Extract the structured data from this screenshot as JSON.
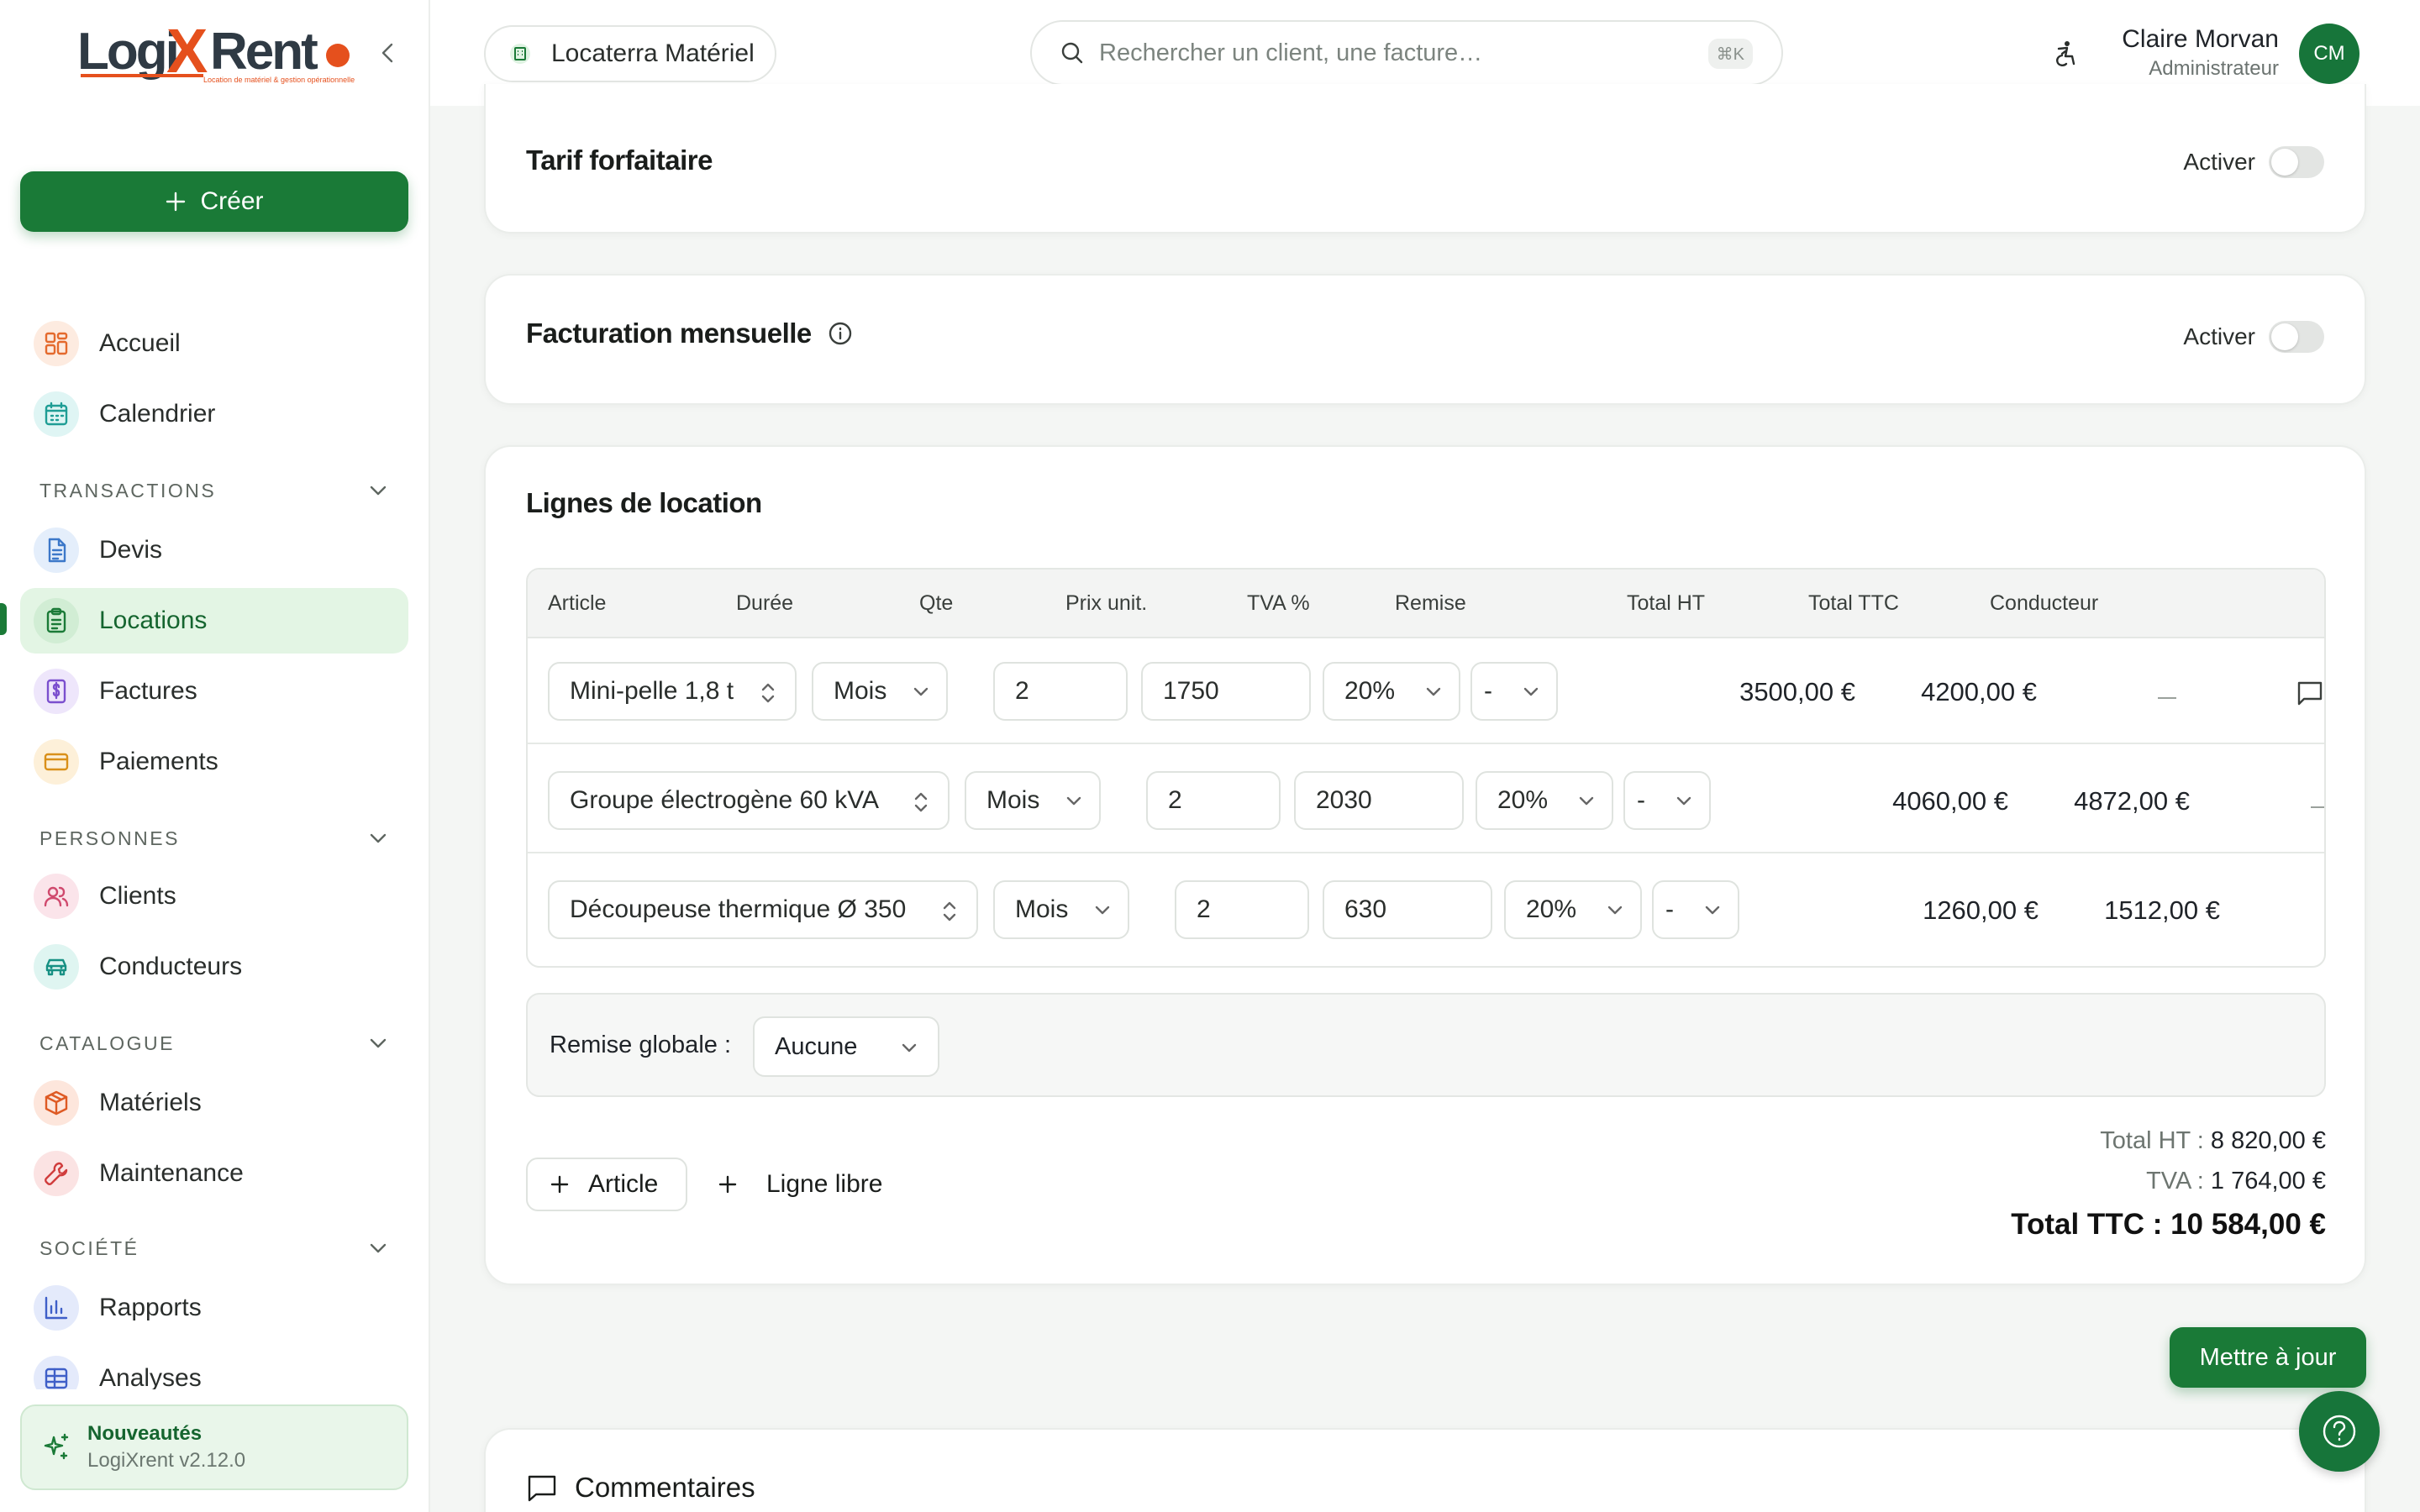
{
  "brand": {
    "logo_text": "LogiXRent",
    "logo_tagline": "Location de matériel & gestion opérationnelle",
    "accent": "#1a7a37"
  },
  "sidebar": {
    "create_label": "Créer",
    "items": [
      {
        "label": "Accueil",
        "icon": "dashboard-icon"
      },
      {
        "label": "Calendrier",
        "icon": "calendar-icon"
      },
      {
        "label": "Devis",
        "icon": "document-icon"
      },
      {
        "label": "Locations",
        "icon": "clipboard-icon",
        "active": true
      },
      {
        "label": "Factures",
        "icon": "dollar-file-icon"
      },
      {
        "label": "Paiements",
        "icon": "card-icon"
      },
      {
        "label": "Clients",
        "icon": "users-icon"
      },
      {
        "label": "Conducteurs",
        "icon": "car-icon"
      },
      {
        "label": "Matériels",
        "icon": "package-icon"
      },
      {
        "label": "Maintenance",
        "icon": "wrench-icon"
      },
      {
        "label": "Rapports",
        "icon": "bar-chart-icon"
      },
      {
        "label": "Analyses",
        "icon": "table-chart-icon"
      }
    ],
    "sections": [
      "TRANSACTIONS",
      "PERSONNES",
      "CATALOGUE",
      "SOCIÉTÉ"
    ],
    "news": {
      "title": "Nouveautés",
      "version": "LogiXrent v2.12.0"
    }
  },
  "topbar": {
    "company": "Locaterra Matériel",
    "search_placeholder": "Rechercher un client, une facture…",
    "shortcut": "⌘K",
    "user_name": "Claire Morvan",
    "user_role": "Administrateur",
    "initials": "CM"
  },
  "tarif": {
    "title": "Tarif forfaitaire",
    "toggle": "Activer",
    "enabled": false
  },
  "mensuelle": {
    "title": "Facturation mensuelle",
    "toggle": "Activer",
    "enabled": false
  },
  "lignes": {
    "title": "Lignes de location",
    "headers": [
      "Article",
      "Durée",
      "Qte",
      "Prix unit.",
      "TVA %",
      "Remise",
      "Total HT",
      "Total TTC",
      "Conducteur"
    ],
    "rows": [
      {
        "article": "Mini-pelle 1,8 t",
        "duree": "Mois",
        "qte": "2",
        "prix": "1750",
        "tva": "20%",
        "remise": "-",
        "total_ht": "3500,00 €",
        "total_ttc": "4200,00 €"
      },
      {
        "article": "Groupe électrogène 60 kVA",
        "duree": "Mois",
        "qte": "2",
        "prix": "2030",
        "tva": "20%",
        "remise": "-",
        "total_ht": "4060,00 €",
        "total_ttc": "4872,00 €"
      },
      {
        "article": "Découpeuse thermique Ø 350",
        "duree": "Mois",
        "qte": "2",
        "prix": "630",
        "tva": "20%",
        "remise": "-",
        "total_ht": "1260,00 €",
        "total_ttc": "1512,00 €"
      }
    ],
    "remise_globale_label": "Remise globale :",
    "remise_globale_value": "Aucune",
    "add_article": "Article",
    "add_libre": "Ligne libre",
    "total_ht_label": "Total HT :",
    "total_ht": "8 820,00 €",
    "tva_label": "TVA :",
    "tva": "1 764,00 €",
    "total_ttc_label": "Total TTC :",
    "total_ttc": "10 584,00 €"
  },
  "update_label": "Mettre à jour",
  "comments_title": "Commentaires"
}
